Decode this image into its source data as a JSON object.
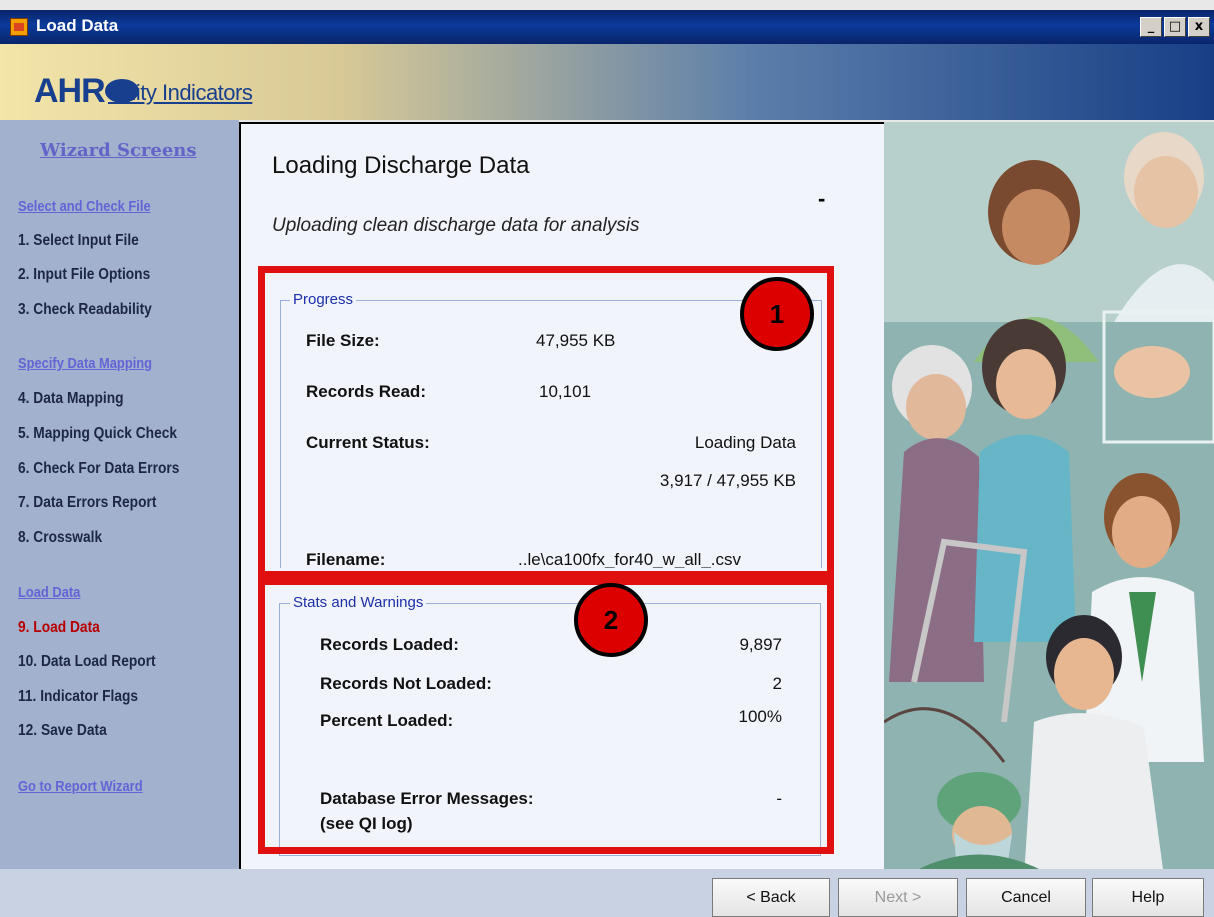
{
  "window": {
    "title": "Load Data",
    "minimize": "_",
    "maximize": "□",
    "close": "x"
  },
  "header": {
    "logo_main": "AHR",
    "logo_sub": "uality Indicators"
  },
  "sidebar": {
    "title": "Wizard Screens",
    "sections": [
      {
        "heading": "Select and Check File",
        "items": [
          "1. Select Input File",
          "2. Input File Options",
          "3. Check Readability"
        ]
      },
      {
        "heading": "Specify Data Mapping",
        "items": [
          "4. Data Mapping",
          "5. Mapping Quick Check",
          "6. Check For Data Errors",
          "7. Data Errors Report",
          "8. Crosswalk"
        ]
      },
      {
        "heading": "Load Data",
        "items": [
          "9. Load Data",
          "10. Data Load Report",
          "11. Indicator Flags",
          "12. Save Data"
        ]
      }
    ],
    "active_item": "9. Load Data",
    "report_link": "Go to Report Wizard"
  },
  "main": {
    "title": "Loading Discharge Data",
    "subtitle": "Uploading clean discharge data for analysis",
    "dash": "-",
    "progress": {
      "legend": "Progress",
      "file_size_label": "File Size:",
      "file_size_value": "47,955 KB",
      "records_read_label": "Records Read:",
      "records_read_value": "10,101",
      "current_status_label": "Current Status:",
      "current_status_value": "Loading Data",
      "bytes_progress": "3,917 / 47,955 KB",
      "filename_label": "Filename:",
      "filename_value": "..le\\ca100fx_for40_w_all_.csv"
    },
    "stats": {
      "legend": "Stats and Warnings",
      "records_loaded_label": "Records Loaded:",
      "records_loaded_value": "9,897",
      "records_not_loaded_label": "Records Not Loaded:",
      "records_not_loaded_value": "2",
      "percent_loaded_label": "Percent Loaded:",
      "percent_loaded_value": "100%",
      "db_errors_label": "Database Error Messages:",
      "db_errors_sub": "(see QI log)",
      "db_errors_value": "-"
    },
    "callouts": [
      "1",
      "2"
    ],
    "highlight_color": "#e01010"
  },
  "buttons": {
    "back": "< Back",
    "next": "Next >",
    "cancel": "Cancel",
    "help": "Help"
  }
}
